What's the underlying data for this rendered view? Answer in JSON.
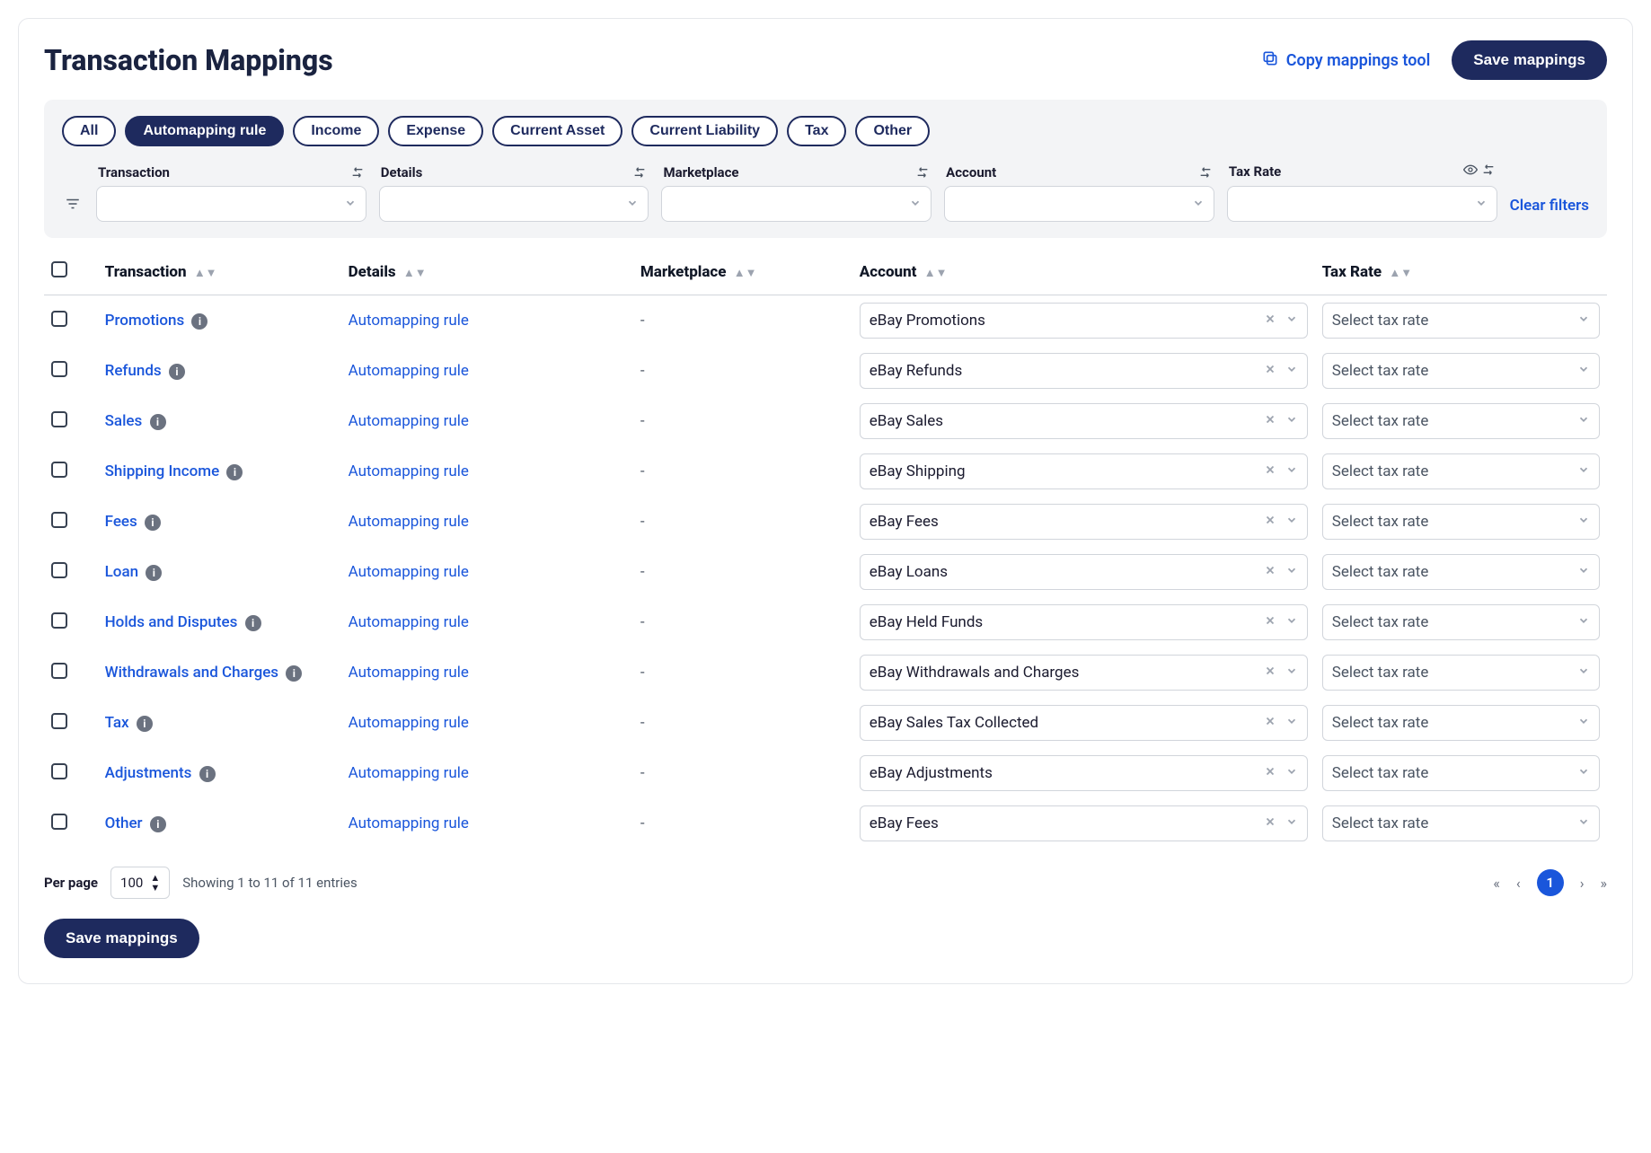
{
  "header": {
    "title": "Transaction Mappings",
    "copy_label": "Copy mappings tool",
    "save_label": "Save mappings"
  },
  "pills": [
    "All",
    "Automapping rule",
    "Income",
    "Expense",
    "Current Asset",
    "Current Liability",
    "Tax",
    "Other"
  ],
  "active_pill_index": 1,
  "filters": {
    "labels": [
      "Transaction",
      "Details",
      "Marketplace",
      "Account",
      "Tax Rate"
    ],
    "clear": "Clear filters"
  },
  "columns": {
    "transaction": "Transaction",
    "details": "Details",
    "marketplace": "Marketplace",
    "account": "Account",
    "tax_rate": "Tax Rate"
  },
  "tax_placeholder": "Select tax rate",
  "details_text": "Automapping rule",
  "marketplace_dash": "-",
  "rows": [
    {
      "transaction": "Promotions",
      "account": "eBay Promotions"
    },
    {
      "transaction": "Refunds",
      "account": "eBay Refunds"
    },
    {
      "transaction": "Sales",
      "account": "eBay Sales"
    },
    {
      "transaction": "Shipping Income",
      "account": "eBay Shipping"
    },
    {
      "transaction": "Fees",
      "account": "eBay Fees"
    },
    {
      "transaction": "Loan",
      "account": "eBay Loans"
    },
    {
      "transaction": "Holds and Disputes",
      "account": "eBay Held Funds"
    },
    {
      "transaction": "Withdrawals and Charges",
      "account": "eBay Withdrawals and Charges"
    },
    {
      "transaction": "Tax",
      "account": "eBay Sales Tax Collected"
    },
    {
      "transaction": "Adjustments",
      "account": "eBay Adjustments"
    },
    {
      "transaction": "Other",
      "account": "eBay Fees"
    }
  ],
  "footer": {
    "perpage_label": "Per page",
    "perpage_value": "100",
    "entries": "Showing 1 to 11 of 11 entries",
    "current_page": "1",
    "save_label": "Save mappings"
  }
}
